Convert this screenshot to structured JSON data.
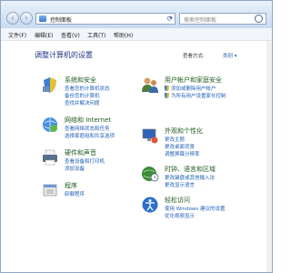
{
  "address": {
    "location": "控制面板",
    "search_placeholder": "搜索控制面板"
  },
  "menu": [
    "文件(F)",
    "编辑(E)",
    "查看(V)",
    "工具(T)",
    "帮助(H)"
  ],
  "page": {
    "title": "调整计算机的设置",
    "view_by_label": "查看方式:",
    "view_by_value": "类别 ▾"
  },
  "categories": [
    {
      "title": "系统和安全",
      "icon": "system-security-icon",
      "links": [
        "查看您的计算机状态",
        "备份您的计算机",
        "查找并解决问题"
      ]
    },
    {
      "title": "网络和 Internet",
      "icon": "network-globe-icon",
      "links": [
        "查看网络状态和任务",
        "选择家庭组和共享选项"
      ]
    },
    {
      "title": "硬件和声音",
      "icon": "printer-icon",
      "links": [
        "查看设备和打印机",
        "添加设备"
      ]
    },
    {
      "title": "程序",
      "icon": "programs-icon",
      "links": [
        "卸载程序"
      ]
    },
    {
      "title": "用户帐户和家庭安全",
      "icon": "users-icon",
      "links": [
        "添加或删除用户帐户",
        "为所有用户设置家长控制"
      ]
    },
    {
      "title": "外观和个性化",
      "icon": "appearance-icon",
      "links": [
        "更改主题",
        "更改桌面背景",
        "调整屏幕分辨率"
      ]
    },
    {
      "title": "时钟、语言和区域",
      "icon": "clock-globe-icon",
      "links": [
        "更改键盘或其他输入法",
        "更改显示语言"
      ]
    },
    {
      "title": "轻松访问",
      "icon": "ease-of-access-icon",
      "links": [
        "使用 Windows 建议的设置",
        "优化视频显示"
      ]
    }
  ]
}
